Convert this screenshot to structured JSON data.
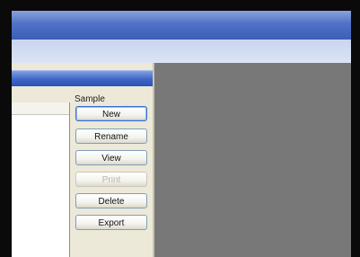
{
  "panel": {
    "group_label": "Sample",
    "buttons": [
      {
        "label": "New",
        "state": "focused"
      },
      {
        "label": "Rename",
        "state": "normal"
      },
      {
        "label": "View",
        "state": "normal"
      },
      {
        "label": "Print",
        "state": "disabled"
      },
      {
        "label": "Delete",
        "state": "normal"
      },
      {
        "label": "Export",
        "state": "normal"
      }
    ]
  },
  "colors": {
    "title_bar": "#3f65c4",
    "desktop": "#787878",
    "window_bg": "#ece9d8"
  }
}
